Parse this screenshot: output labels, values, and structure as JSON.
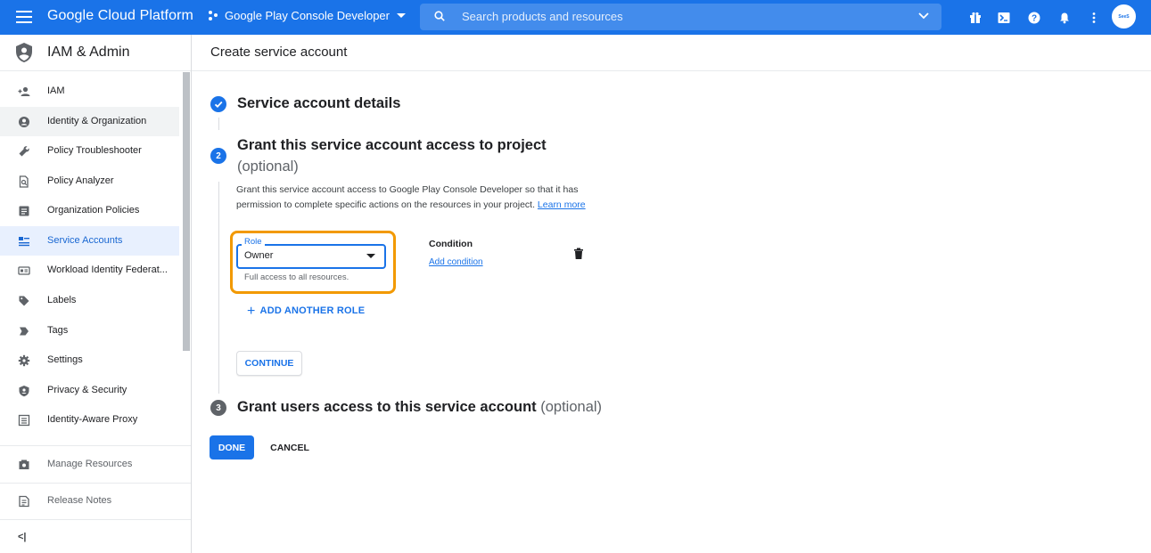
{
  "topbar": {
    "brand": "Google Cloud Platform",
    "project": "Google Play Console Developer",
    "search_placeholder": "Search products and resources",
    "icons": [
      "gift-icon",
      "terminal-icon",
      "help-icon",
      "bell-icon",
      "more-vert-icon"
    ],
    "avatar_text": "SeeS",
    "accent": "#1a73e8"
  },
  "sidebar": {
    "title": "IAM & Admin",
    "items": [
      {
        "label": "IAM",
        "icon": "person-add-icon"
      },
      {
        "label": "Identity & Organization",
        "icon": "account-circle-icon"
      },
      {
        "label": "Policy Troubleshooter",
        "icon": "wrench-icon"
      },
      {
        "label": "Policy Analyzer",
        "icon": "document-search-icon"
      },
      {
        "label": "Organization Policies",
        "icon": "list-doc-icon"
      },
      {
        "label": "Service Accounts",
        "icon": "service-account-icon"
      },
      {
        "label": "Workload Identity Federat...",
        "icon": "id-card-icon"
      },
      {
        "label": "Labels",
        "icon": "label-icon"
      },
      {
        "label": "Tags",
        "icon": "tag-arrow-icon"
      },
      {
        "label": "Settings",
        "icon": "gear-icon"
      },
      {
        "label": "Privacy & Security",
        "icon": "shield-small-icon"
      },
      {
        "label": "Identity-Aware Proxy",
        "icon": "proxy-icon"
      }
    ],
    "bottom": [
      {
        "label": "Manage Resources",
        "icon": "manage-resources-icon"
      },
      {
        "label": "Release Notes",
        "icon": "release-notes-icon"
      }
    ],
    "collapse_glyph": "<|"
  },
  "main": {
    "page_title": "Create service account",
    "step1": {
      "title": "Service account details"
    },
    "step2": {
      "number": "2",
      "title": "Grant this service account access to project",
      "optional": "(optional)",
      "description": "Grant this service account access to Google Play Console Developer so that it has permission to complete specific actions on the resources in your project.",
      "learn_more": "Learn more",
      "role_label": "Role",
      "role_value": "Owner",
      "role_helper": "Full access to all resources.",
      "condition_label": "Condition",
      "add_condition": "Add condition",
      "add_another_role": "ADD ANOTHER ROLE",
      "continue": "CONTINUE"
    },
    "step3": {
      "number": "3",
      "title": "Grant users access to this service account",
      "optional": "(optional)"
    },
    "done": "DONE",
    "cancel": "CANCEL",
    "highlight_color": "#f29900"
  }
}
